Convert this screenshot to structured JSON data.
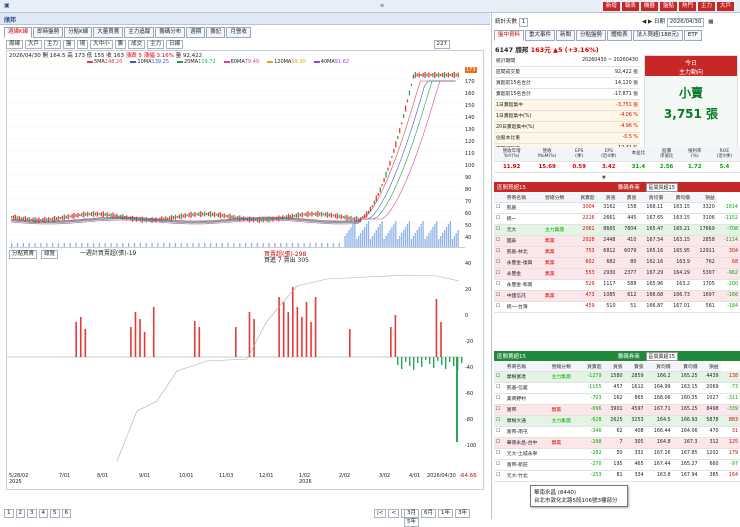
{
  "window": {
    "title": "頎邦"
  },
  "top_buttons": [
    "新增",
    "報表",
    "機器",
    "盤點",
    "熱門",
    "主力",
    "大戶"
  ],
  "chart_tabs": [
    "週線K線",
    "即時盤勢",
    "分點K線",
    "大量買賣",
    "主力追蹤",
    "籌碼分布",
    "週期",
    "籌記",
    "月營收"
  ],
  "toolbar": {
    "items": [
      "周線",
      "大戶",
      "主力",
      "盤",
      "現",
      "大中小",
      "籌",
      "成交",
      "主力",
      "日線"
    ],
    "count": "227"
  },
  "quote_line": {
    "date": "2026/04/30",
    "open": "開 164.5",
    "high": "高 173",
    "low": "低 155",
    "close": "收 163",
    "change": "漲跌 5",
    "pct": "漲幅 3.16%",
    "vol": "量 92,422"
  },
  "ma_legend": [
    {
      "label": "5MA",
      "value": "148.20",
      "color": "#e04040"
    },
    {
      "label": "10MA",
      "value": "139.25",
      "color": "#3060d0"
    },
    {
      "label": "20MA",
      "value": "119.72",
      "color": "#20a040"
    },
    {
      "label": "60MA",
      "value": "79.49",
      "color": "#e040a0"
    },
    {
      "label": "120MA",
      "value": "69.30",
      "color": "#e0a020"
    },
    {
      "label": "40MA",
      "value": "91.62",
      "color": "#a040e0"
    }
  ],
  "price_axis": [
    "173",
    "170",
    "160",
    "150",
    "140",
    "130",
    "120",
    "110",
    "100",
    "90",
    "80",
    "70",
    "60",
    "50",
    "40"
  ],
  "chip_panel": {
    "select": "分點買賣",
    "btn": "總覽",
    "legend_a": "一週計買賣超(張)-19",
    "legend_b": "買賣超(張)-298",
    "legend_c": "買進 7 賣出 305"
  },
  "chip_axis": [
    "40",
    "20",
    "0",
    "-20",
    "-40",
    "-60",
    "-80",
    "-100"
  ],
  "last_value": "-64.66",
  "dates": [
    "5/28/02\n2025",
    "7/01",
    "8/01",
    "9/01",
    "10/01",
    "11/03",
    "12/01",
    "1/02\n2026",
    "2/02",
    "3/02",
    "4/01",
    "2026/04/30"
  ],
  "bottom_pages": [
    "1",
    "2",
    "3",
    "4",
    "5",
    "6"
  ],
  "range_buttons": [
    "3月",
    "6月",
    "1年",
    "3年",
    "5年"
  ],
  "right": {
    "period_label": "統計天數",
    "period": "1",
    "date_label": "日期",
    "date": "2026/04/30",
    "sub_tabs": [
      "盤中資料",
      "重大事件",
      "新聞",
      "分點盤勢",
      "體檢表",
      "法人買超(188元)",
      "ETF"
    ],
    "stock": {
      "code": "6147",
      "name": "頎邦",
      "price": "163元",
      "change": "▲5",
      "pct": "(+3.16%)"
    },
    "stats": [
      {
        "k": "統計期間",
        "v": "20260430 ~ 20260430",
        "c": ""
      },
      {
        "k": "區間成交量",
        "v": "92,422 張",
        "c": ""
      },
      {
        "k": "買超前15名合計",
        "v": "14,120 張",
        "c": ""
      },
      {
        "k": "賣超前15名合計",
        "v": "-17,871 張",
        "c": ""
      },
      {
        "k": "1日賣超集中",
        "v": "-3,751 張",
        "c": "red"
      },
      {
        "k": "1日賣超集中(%)",
        "v": "-4.06 %",
        "c": "red"
      },
      {
        "k": "20日賣超集中(%)",
        "v": "-4.96 %",
        "c": "red"
      },
      {
        "k": "佔股本比重",
        "v": "-0.5 %",
        "c": "red"
      },
      {
        "k": "區間周轉率",
        "v": "12.41 %",
        "c": ""
      }
    ],
    "today_box": {
      "title": "今日",
      "sub": "主力動向",
      "label": "小賣",
      "value": "3,751 張"
    },
    "metrics": [
      {
        "h": "營收年增\nYoY(%)",
        "v": "11.92",
        "c": "red"
      },
      {
        "h": "營收\nMoM(%)",
        "v": "15.69",
        "c": "red"
      },
      {
        "h": "EPS\n(季)",
        "v": "0.59",
        "c": "red"
      },
      {
        "h": "EPS\n(近4季)",
        "v": "3.42",
        "c": "red"
      },
      {
        "h": "本益比",
        "v": "31.4",
        "c": "grn"
      },
      {
        "h": "股價\n淨值比",
        "v": "2.56",
        "c": "grn"
      },
      {
        "h": "殖利率\n(%)",
        "v": "1.72",
        "c": "grn"
      },
      {
        "h": "ROE\n(近4季)",
        "v": "5.4",
        "c": "grn"
      }
    ],
    "buy_title": "區間買超15",
    "buy_filter": "籌碼券商",
    "buy_select": "區間買超15",
    "cols": [
      "",
      "券商名稱",
      "營總分類",
      "買賣超",
      "買張",
      "賣張",
      "買均價",
      "賣均價",
      "損益"
    ],
    "buy_rows": [
      [
        "凱基",
        "",
        "3004",
        "3162",
        "158",
        "168.11",
        "163.15",
        "3320",
        "-1614"
      ],
      [
        "統一",
        "",
        "2216",
        "2661",
        "445",
        "167.65",
        "163.15",
        "3106",
        "-1152"
      ],
      [
        "元大",
        "主力集團",
        "2061",
        "8665",
        "7804",
        "165.47",
        "165.21",
        "17669",
        "-708"
      ],
      [
        "國泰",
        "無黨",
        "2028",
        "2448",
        "410",
        "167.54",
        "163.15",
        "2858",
        "-1114"
      ],
      [
        "凱基-林北",
        "無黨",
        "753",
        "6812",
        "6079",
        "165.16",
        "165.95",
        "12911",
        "304"
      ],
      [
        "永豐金-復興",
        "無黨",
        "602",
        "682",
        "80",
        "162.16",
        "163.9",
        "762",
        "68"
      ],
      [
        "永豐金",
        "無黨",
        "553",
        "2930",
        "2377",
        "167.29",
        "164.29",
        "5307",
        "-962"
      ],
      [
        "永豐金-和南",
        "",
        "529",
        "1117",
        "588",
        "165.96",
        "163.2",
        "1705",
        "-200"
      ],
      [
        "中國信託",
        "無黨",
        "473",
        "1085",
        "612",
        "166.68",
        "166.73",
        "1697",
        "-166"
      ],
      [
        "統一-台灣",
        "",
        "459",
        "510",
        "51",
        "166.87",
        "167.01",
        "561",
        "-184"
      ]
    ],
    "sell_title": "區間賣超15",
    "sell_filter": "籌碼券商",
    "sell_select": "區間賣超15",
    "sell_rows": [
      [
        "摩根富達",
        "主力集團",
        "-1279",
        "1580",
        "2859",
        "166.2",
        "165.25",
        "4439",
        "138"
      ],
      [
        "凱基-信義",
        "",
        "-1155",
        "457",
        "1612",
        "164.99",
        "163.15",
        "2069",
        "-73"
      ],
      [
        "美商野村",
        "",
        "-703",
        "162",
        "865",
        "168.06",
        "160.35",
        "1027",
        "-311"
      ],
      [
        "富邦",
        "無黨",
        "-696",
        "3901",
        "4597",
        "167.71",
        "165.25",
        "8498",
        "-339"
      ],
      [
        "摩根大通",
        "主力集團",
        "-628",
        "2625",
        "3253",
        "164.5",
        "166.93",
        "5878",
        "883"
      ],
      [
        "富邦-南屯",
        "",
        "-346",
        "62",
        "408",
        "166.44",
        "164.06",
        "470",
        "31"
      ],
      [
        "華南永昌-台中",
        "無黨",
        "-298",
        "7",
        "305",
        "164.8",
        "167.3",
        "312",
        "125"
      ],
      [
        "元大-土城永寧",
        "",
        "-282",
        "50",
        "332",
        "167.16",
        "167.85",
        "1202",
        "179"
      ],
      [
        "富邦-新莊",
        "",
        "-270",
        "195",
        "465",
        "167.44",
        "165.27",
        "660",
        "-97"
      ],
      [
        "元大-竹北",
        "",
        "-253",
        "81",
        "334",
        "163.8",
        "167.94",
        "385",
        "164"
      ]
    ],
    "tooltip": {
      "line1": "華南永昌 (8440)",
      "line2": "台北市敦化北路5段106號3樓部分"
    }
  }
}
